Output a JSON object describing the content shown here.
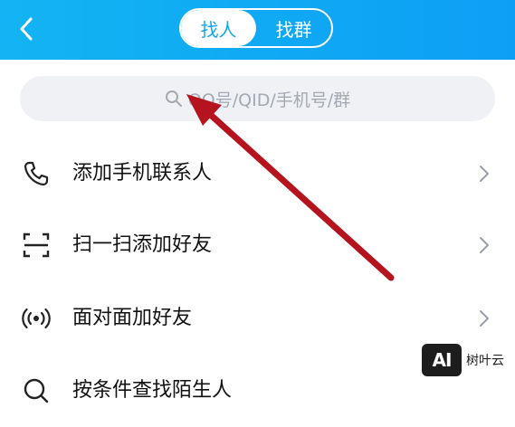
{
  "header": {
    "tabs": [
      {
        "label": "找人",
        "active": true
      },
      {
        "label": "找群",
        "active": false
      }
    ]
  },
  "search": {
    "placeholder": "QQ号/QID/手机号/群"
  },
  "menu": [
    {
      "label": "添加手机联系人",
      "icon": "phone-icon"
    },
    {
      "label": "扫一扫添加好友",
      "icon": "scan-icon"
    },
    {
      "label": "面对面加好友",
      "icon": "radar-icon"
    },
    {
      "label": "按条件查找陌生人",
      "icon": "search-icon"
    }
  ],
  "watermark": {
    "logo": "AI",
    "text": "树叶云"
  },
  "colors": {
    "header": "#12b4f3",
    "accent": "#0fa8f0",
    "arrow": "#b5141e"
  }
}
